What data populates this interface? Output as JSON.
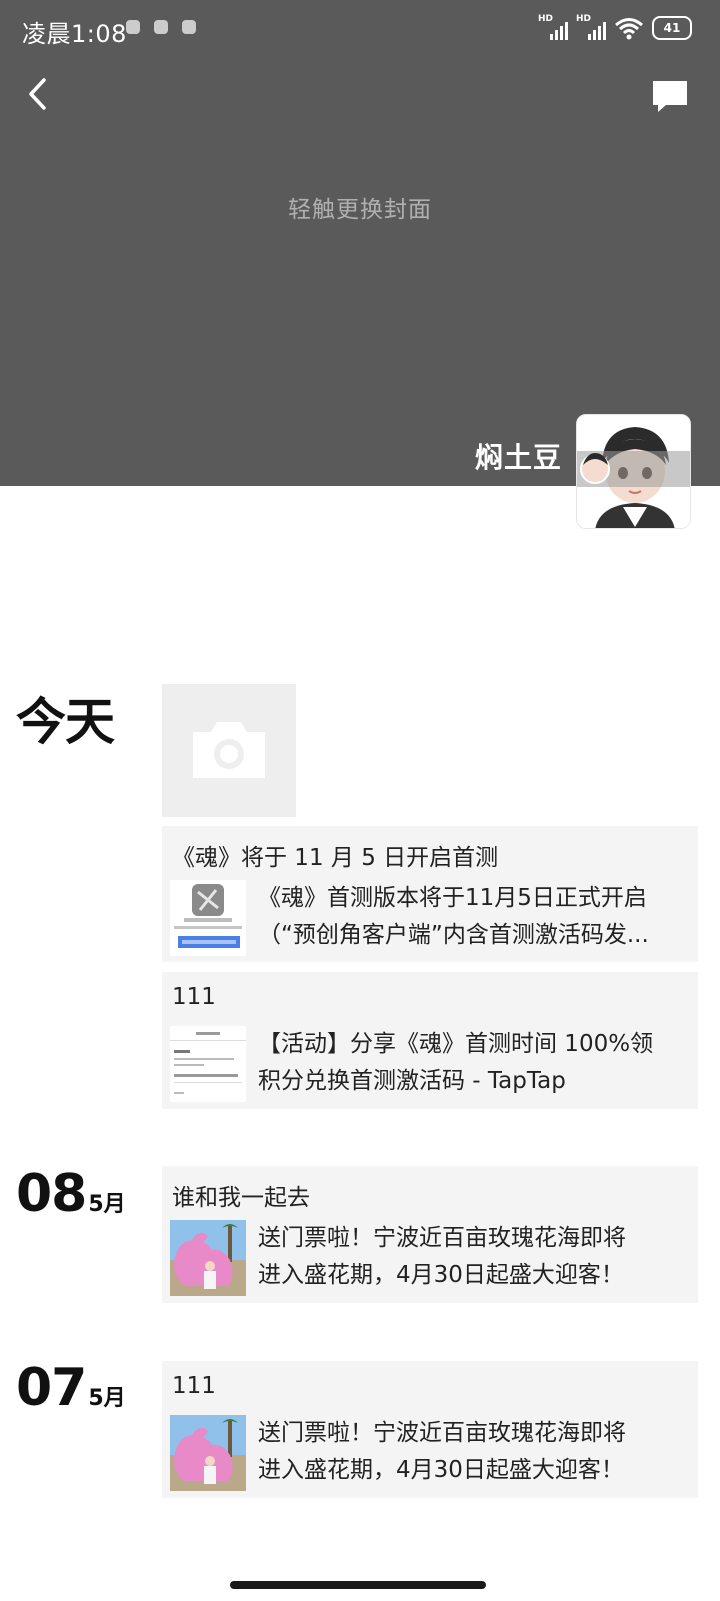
{
  "status_bar": {
    "time": "凌晨1:08",
    "network_label": "HD",
    "battery": "41"
  },
  "header": {
    "cover_hint": "轻触更换封面",
    "profile_name": "焖土豆"
  },
  "timeline": {
    "today_label": "今天",
    "posts_today": [
      {
        "title": "《魂》将于 11 月 5 日开启首测",
        "line1": "《魂》首测版本将于11月5日正式开启",
        "line2": "（“预创角客户端”内含首测激活码发..."
      },
      {
        "title": "111",
        "line1": "【活动】分享《魂》首测时间 100%领",
        "line2": "积分兑换首测激活码 - TapTap"
      }
    ],
    "day_08": {
      "day": "08",
      "month": "5月",
      "title": "谁和我一起去",
      "line1": "送门票啦！宁波近百亩玫瑰花海即将",
      "line2": "进入盛花期，4月30日起盛大迎客！"
    },
    "day_07": {
      "day": "07",
      "month": "5月",
      "title": "111",
      "line1": "送门票啦！宁波近百亩玫瑰花海即将",
      "line2": "进入盛花期，4月30日起盛大迎客！"
    }
  }
}
